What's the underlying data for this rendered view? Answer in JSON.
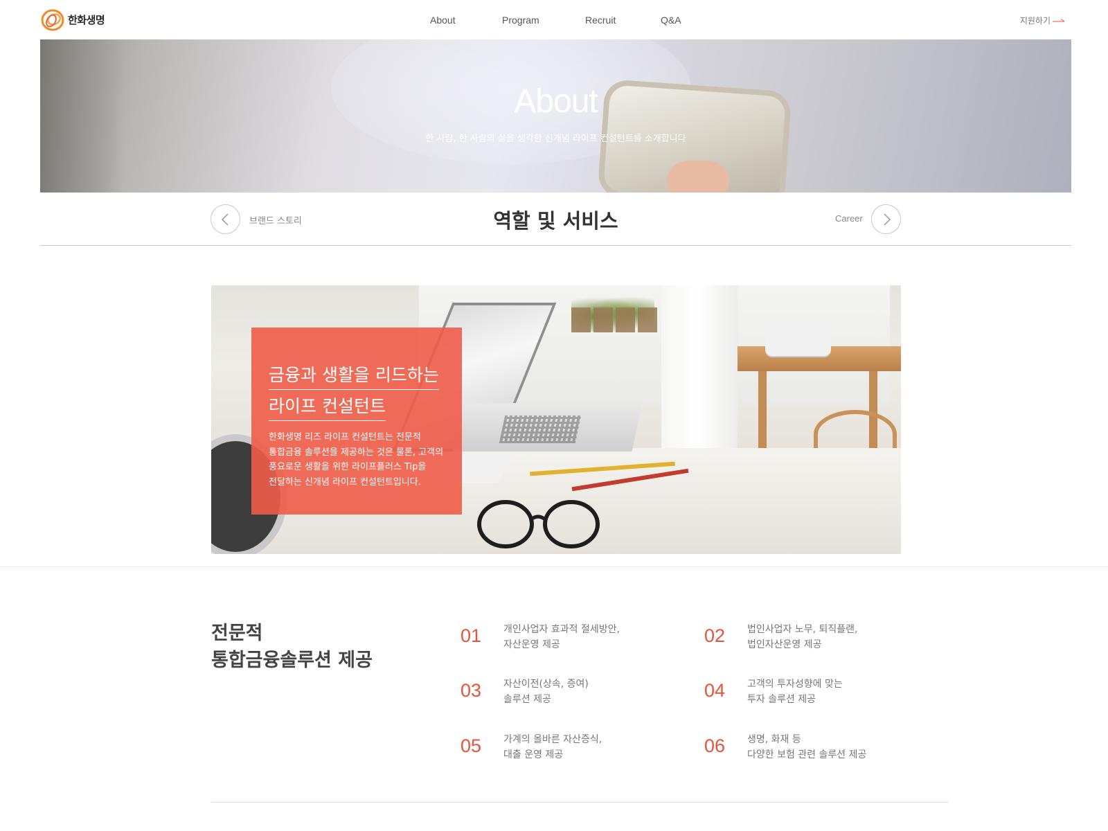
{
  "brand": {
    "name": "한화생명",
    "accent": "#f08a28"
  },
  "nav": {
    "items": [
      "About",
      "Program",
      "Recruit",
      "Q&A"
    ],
    "apply_label": "지원하기",
    "apply_arrow_icon": "right-arrow-icon"
  },
  "hero": {
    "title": "About",
    "subtitle": "한 사람, 한 사람의 삶을 생각한 신개념 라이프 컨설턴트를 소개합니다"
  },
  "subnav": {
    "prev_label": "브랜드 스토리",
    "title": "역할 및 서비스",
    "next_label": "Career"
  },
  "feature": {
    "title_line1": "금융과 생활을 리드하는",
    "title_line2": "라이프 컨설턴트",
    "description": "한화생명 리즈 라이프 컨설턴트는 전문적\n통합금융 솔루션을 제공하는 것은 물론, 고객의\n풍요로운 생활을 위한 라이프플러스 Tip을\n전달하는 신개념 라이프 컨설턴트입니다.",
    "box_color": "#f05c48"
  },
  "solutions": {
    "heading": "전문적\n통합금융솔루션 제공",
    "number_color": "#e6543d",
    "items": [
      {
        "num": "01",
        "text": "개인사업자 효과적 절세방안,\n자산운영 제공"
      },
      {
        "num": "02",
        "text": "법인사업자 노무, 퇴직플랜,\n법인자산운영 제공"
      },
      {
        "num": "03",
        "text": "자산이전(상속, 증여)\n솔루션 제공"
      },
      {
        "num": "04",
        "text": "고객의 투자성향에 맞는\n투자 솔루션 제공"
      },
      {
        "num": "05",
        "text": "가계의 올바른 자산증식,\n대출 운영 제공"
      },
      {
        "num": "06",
        "text": "생명, 화재 등\n다양한 보험 관련 솔루션 제공"
      }
    ]
  }
}
